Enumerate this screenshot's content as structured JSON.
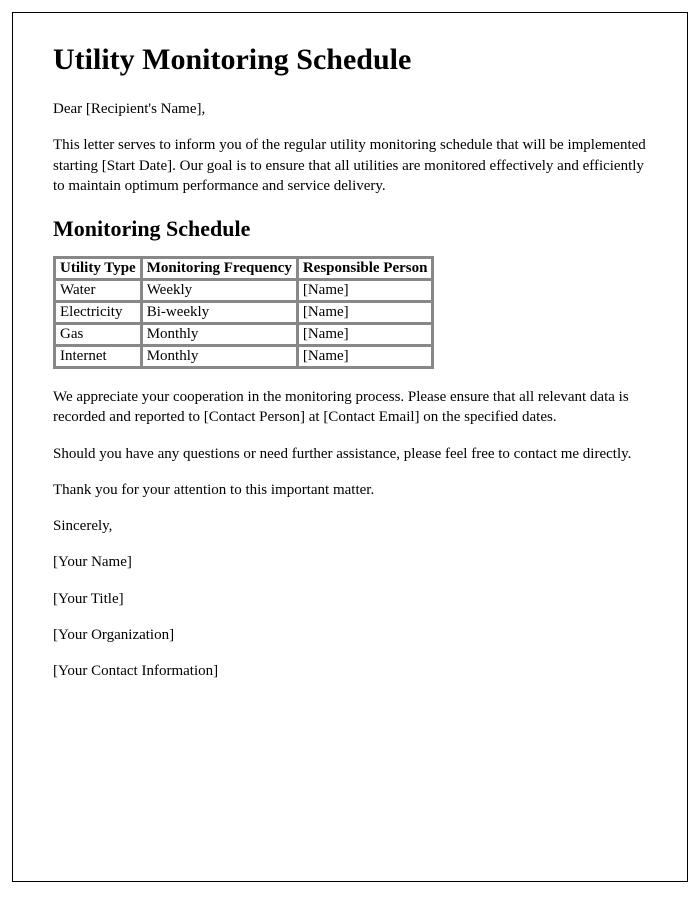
{
  "title": "Utility Monitoring Schedule",
  "greeting": "Dear [Recipient's Name],",
  "intro": "This letter serves to inform you of the regular utility monitoring schedule that will be implemented starting [Start Date]. Our goal is to ensure that all utilities are monitored effectively and efficiently to maintain optimum performance and service delivery.",
  "schedule_heading": "Monitoring Schedule",
  "table": {
    "headers": [
      "Utility Type",
      "Monitoring Frequency",
      "Responsible Person"
    ],
    "rows": [
      [
        "Water",
        "Weekly",
        "[Name]"
      ],
      [
        "Electricity",
        "Bi-weekly",
        "[Name]"
      ],
      [
        "Gas",
        "Monthly",
        "[Name]"
      ],
      [
        "Internet",
        "Monthly",
        "[Name]"
      ]
    ]
  },
  "cooperation": "We appreciate your cooperation in the monitoring process. Please ensure that all relevant data is recorded and reported to [Contact Person] at [Contact Email] on the specified dates.",
  "questions": "Should you have any questions or need further assistance, please feel free to contact me directly.",
  "thanks": "Thank you for your attention to this important matter.",
  "closing": "Sincerely,",
  "signature": {
    "name": "[Your Name]",
    "title": "[Your Title]",
    "org": "[Your Organization]",
    "contact": "[Your Contact Information]"
  }
}
